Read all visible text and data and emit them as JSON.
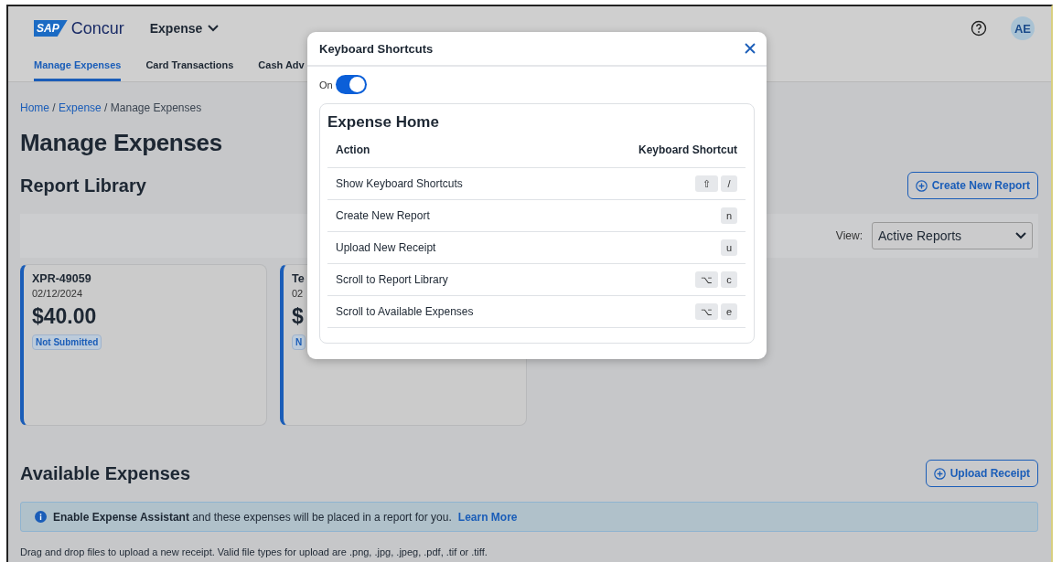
{
  "header": {
    "logo": {
      "badge": "SAP",
      "name": "Concur"
    },
    "product_menu": "Expense",
    "tabs": [
      {
        "label": "Manage Expenses",
        "selected": true
      },
      {
        "label": "Card Transactions",
        "selected": false
      },
      {
        "label": "Cash Adv",
        "selected": false
      }
    ],
    "avatar": "AE"
  },
  "breadcrumb_separator": "/",
  "breadcrumb": [
    {
      "label": "Home",
      "link": true
    },
    {
      "label": "Expense",
      "link": true
    },
    {
      "label": "Manage Expenses",
      "link": false
    }
  ],
  "page_title": "Manage Expenses",
  "report_library": {
    "title": "Report Library",
    "create_button": "Create New Report",
    "view_label": "View:",
    "view_value": "Active Reports",
    "cards": [
      {
        "title": "XPR-49059",
        "date": "02/12/2024",
        "amount": "$40.00",
        "status": "Not Submitted"
      },
      {
        "title": "Te",
        "date": "02",
        "amount": "$",
        "status": "N"
      }
    ]
  },
  "available_expenses": {
    "title": "Available Expenses",
    "upload_button": "Upload Receipt",
    "info": {
      "bold": "Enable Expense Assistant",
      "text": "and these expenses will be placed in a report for you.",
      "link": "Learn More"
    },
    "drop_hint": "Drag and drop files to upload a new receipt. Valid file types for upload are .png, .jpg, .jpeg, .pdf, .tif or .tiff."
  },
  "modal": {
    "title": "Keyboard Shortcuts",
    "toggle": {
      "label": "On",
      "on": true
    },
    "section": "Expense Home",
    "columns": [
      "Action",
      "Keyboard Shortcut"
    ],
    "rows": [
      {
        "action": "Show Keyboard Shortcuts",
        "keys": [
          "⇧",
          "/"
        ]
      },
      {
        "action": "Create New Report",
        "keys": [
          "n"
        ]
      },
      {
        "action": "Upload New Receipt",
        "keys": [
          "u"
        ]
      },
      {
        "action": "Scroll to Report Library",
        "keys": [
          "⌥",
          "c"
        ]
      },
      {
        "action": "Scroll to Available Expenses",
        "keys": [
          "⌥",
          "e"
        ]
      }
    ]
  }
}
